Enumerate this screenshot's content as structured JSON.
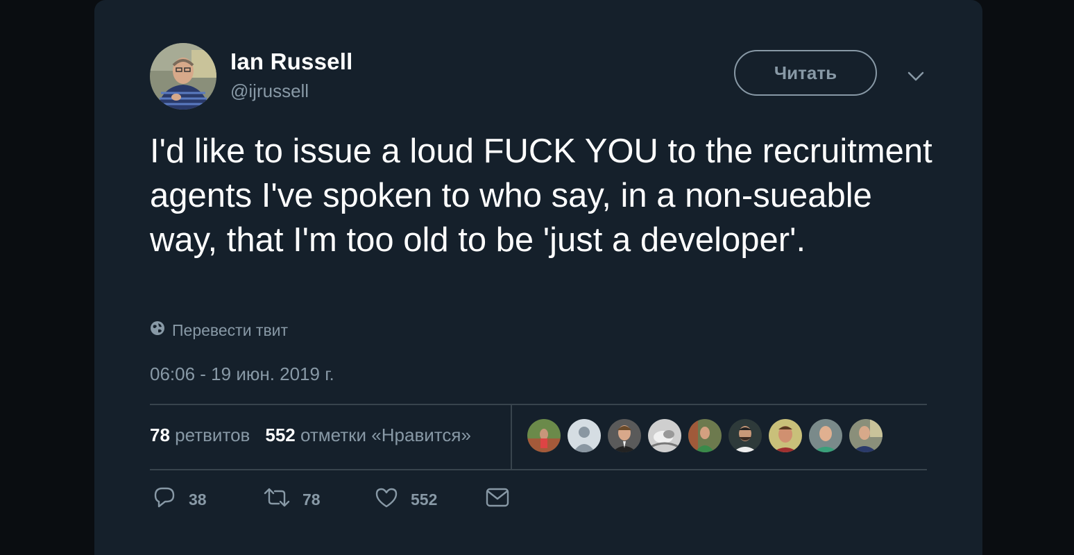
{
  "tweet": {
    "author_name": "Ian Russell",
    "author_handle": "@ijrussell",
    "follow_label": "Читать",
    "text": "I'd like to issue a loud FUCK YOU to the recruitment agents I've spoken to who say, in a non-sueable way, that I'm too old to be 'just a developer'.",
    "translate_label": "Перевести твит",
    "timestamp": "06:06 - 19 июн. 2019 г."
  },
  "stats": {
    "retweets_count": "78",
    "retweets_label": "ретвитов",
    "likes_count": "552",
    "likes_label": "отметки «Нравится»"
  },
  "actions": {
    "replies": "38",
    "retweets": "78",
    "likes": "552"
  },
  "colors": {
    "background": "#0a0d11",
    "card": "#15202b",
    "secondary_text": "#8899a6",
    "divider": "#38444d"
  }
}
